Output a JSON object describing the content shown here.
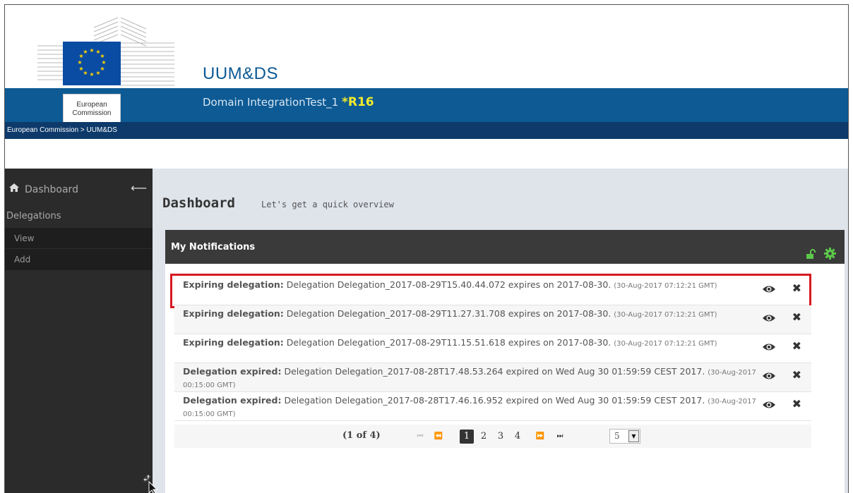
{
  "header": {
    "logo_text": "European\nCommission",
    "app_title": "UUM&DS",
    "domain_prefix": "Domain IntegrationTest_1 ",
    "release": "*R16"
  },
  "breadcrumb": "European Commission > UUM&DS",
  "sidebar": {
    "dashboard_label": "Dashboard",
    "group_label": "Delegations",
    "items": [
      {
        "label": "View"
      },
      {
        "label": "Add"
      }
    ]
  },
  "page": {
    "title": "Dashboard",
    "subtitle": "Let's get a quick overview"
  },
  "panel": {
    "title": "My Notifications",
    "notifications": [
      {
        "kind": "Expiring delegation:",
        "message": "Delegation Delegation_2017-08-29T15.40.44.072 expires on 2017-08-30.",
        "time": "(30-Aug-2017 07:12:21 GMT)",
        "highlighted": true
      },
      {
        "kind": "Expiring delegation:",
        "message": "Delegation Delegation_2017-08-29T11.27.31.708 expires on 2017-08-30.",
        "time": "(30-Aug-2017 07:12:21 GMT)"
      },
      {
        "kind": "Expiring delegation:",
        "message": "Delegation Delegation_2017-08-29T11.15.51.618 expires on 2017-08-30.",
        "time": "(30-Aug-2017 07:12:21 GMT)"
      },
      {
        "kind": "Delegation expired:",
        "message": "Delegation Delegation_2017-08-28T17.48.53.264 expired on Wed Aug 30 01:59:59 CEST 2017.",
        "time": "(30-Aug-2017 00:15:00 GMT)"
      },
      {
        "kind": "Delegation expired:",
        "message": "Delegation Delegation_2017-08-28T17.46.16.952 expired on Wed Aug 30 01:59:59 CEST 2017.",
        "time": "(30-Aug-2017 00:15:00 GMT)"
      }
    ],
    "paginator": {
      "info": "(1 of 4)",
      "pages": [
        "1",
        "2",
        "3",
        "4"
      ],
      "current": "1",
      "rows_per_page": "5"
    }
  },
  "colors": {
    "brand_blue": "#0d5a94",
    "breadcrumb_bg": "#0d3a6b",
    "release_yellow": "#f4ec2c",
    "highlight_red": "#d71920",
    "accent_green": "#5cc84a"
  }
}
